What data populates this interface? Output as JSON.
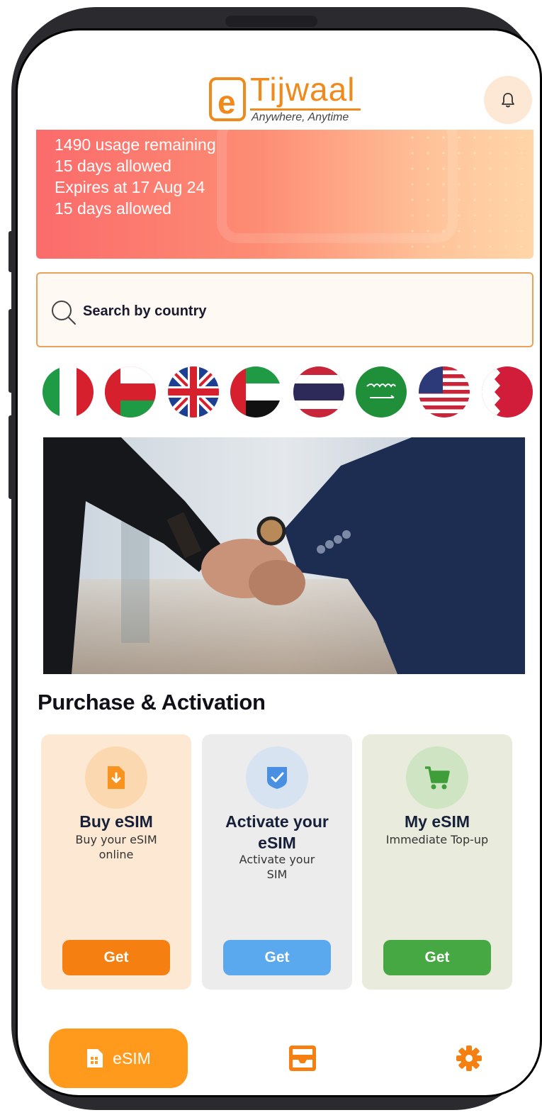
{
  "header": {
    "logo_letter": "e",
    "logo_name": "Tijwaal",
    "logo_tagline": "Anywhere, Anytime",
    "bell_icon": "bell-icon"
  },
  "banner": {
    "lines": [
      "1490 usage remaining",
      "15 days allowed",
      "Expires at 17 Aug 24",
      "15 days allowed"
    ]
  },
  "search": {
    "placeholder": "Search by country",
    "icon": "search-icon"
  },
  "flags": [
    "Italy",
    "Oman",
    "United Kingdom",
    "United Arab Emirates",
    "Thailand",
    "Saudi Arabia",
    "United States",
    "Bahrain"
  ],
  "section": {
    "title": "Purchase & Activation"
  },
  "cards": [
    {
      "title": "Buy eSIM",
      "subtitle": "Buy your  eSIM online",
      "button": "Get",
      "icon": "sim-card-icon",
      "bg": "#fde9d3",
      "circle": "#fcd8b0",
      "icon_color": "#f7931e",
      "btn_color": "#f57f10"
    },
    {
      "title": "Activate your eSIM",
      "subtitle": "Activate your SIM",
      "button": "Get",
      "icon": "shield-check-icon",
      "bg": "#ececec",
      "circle": "#d8e3f2",
      "icon_color": "#4a90e2",
      "btn_color": "#5aa9ee"
    },
    {
      "title": "My eSIM",
      "subtitle": "Immediate Top-up",
      "button": "Get",
      "icon": "cart-icon",
      "bg": "#e9ecdc",
      "circle": "#cfe4c2",
      "icon_color": "#3f9e3a",
      "btn_color": "#46a843"
    }
  ],
  "bottom_nav": {
    "items": [
      {
        "label": "eSIM",
        "icon": "sim-card-icon",
        "active": true
      },
      {
        "label": "",
        "icon": "inbox-icon",
        "active": false
      },
      {
        "label": "",
        "icon": "gear-icon",
        "active": false
      }
    ],
    "accent": "#ff9a1c"
  }
}
